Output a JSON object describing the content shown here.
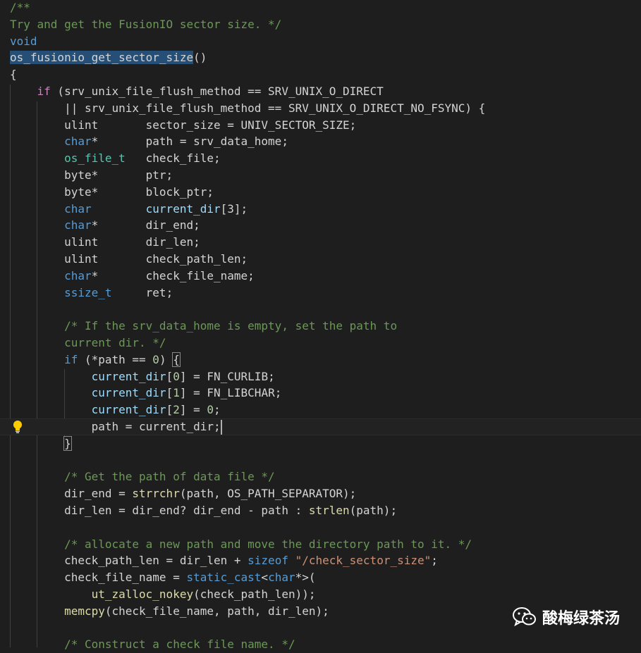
{
  "editor": {
    "lines": [
      [
        {
          "t": "/**",
          "c": "comment"
        }
      ],
      [
        {
          "t": "Try and get the FusionIO sector size. */",
          "c": "comment"
        }
      ],
      [
        {
          "t": "void",
          "c": "keyword"
        }
      ],
      [
        {
          "t": "os_fusionio_get_sector_size",
          "c": "sel"
        },
        {
          "t": "()",
          "c": "plain"
        }
      ],
      [
        {
          "t": "{",
          "c": "plain"
        }
      ],
      [
        {
          "t": "    ",
          "c": "plain"
        },
        {
          "t": "if",
          "c": "control"
        },
        {
          "t": " (srv_unix_file_flush_method == SRV_UNIX_O_DIRECT",
          "c": "plain"
        }
      ],
      [
        {
          "t": "        || srv_unix_file_flush_method == SRV_UNIX_O_DIRECT_NO_FSYNC) {",
          "c": "plain"
        }
      ],
      [
        {
          "t": "        ulint       sector_size = UNIV_SECTOR_SIZE;",
          "c": "plain"
        }
      ],
      [
        {
          "t": "        ",
          "c": "plain"
        },
        {
          "t": "char",
          "c": "keyword"
        },
        {
          "t": "*       path = srv_data_home;",
          "c": "plain"
        }
      ],
      [
        {
          "t": "        ",
          "c": "plain"
        },
        {
          "t": "os_file_t",
          "c": "type"
        },
        {
          "t": "   check_file;",
          "c": "plain"
        }
      ],
      [
        {
          "t": "        byte*       ptr;",
          "c": "plain"
        }
      ],
      [
        {
          "t": "        byte*       block_ptr;",
          "c": "plain"
        }
      ],
      [
        {
          "t": "        ",
          "c": "plain"
        },
        {
          "t": "char",
          "c": "keyword"
        },
        {
          "t": "        ",
          "c": "plain"
        },
        {
          "t": "current_dir",
          "c": "var"
        },
        {
          "t": "[3];",
          "c": "plain"
        }
      ],
      [
        {
          "t": "        ",
          "c": "plain"
        },
        {
          "t": "char",
          "c": "keyword"
        },
        {
          "t": "*       dir_end;",
          "c": "plain"
        }
      ],
      [
        {
          "t": "        ulint       dir_len;",
          "c": "plain"
        }
      ],
      [
        {
          "t": "        ulint       check_path_len;",
          "c": "plain"
        }
      ],
      [
        {
          "t": "        ",
          "c": "plain"
        },
        {
          "t": "char",
          "c": "keyword"
        },
        {
          "t": "*       check_file_name;",
          "c": "plain"
        }
      ],
      [
        {
          "t": "        ",
          "c": "plain"
        },
        {
          "t": "ssize_t",
          "c": "keyword"
        },
        {
          "t": "     ret;",
          "c": "plain"
        }
      ],
      [
        {
          "t": "",
          "c": "plain"
        }
      ],
      [
        {
          "t": "        ",
          "c": "plain"
        },
        {
          "t": "/* If the srv_data_home is empty, set the path to",
          "c": "comment"
        }
      ],
      [
        {
          "t": "        ",
          "c": "plain"
        },
        {
          "t": "current dir. */",
          "c": "comment"
        }
      ],
      [
        {
          "t": "        ",
          "c": "plain"
        },
        {
          "t": "if",
          "c": "keyword"
        },
        {
          "t": " (*path == ",
          "c": "plain"
        },
        {
          "t": "0",
          "c": "number"
        },
        {
          "t": ") ",
          "c": "plain"
        },
        {
          "t": "{",
          "c": "brace"
        }
      ],
      [
        {
          "t": "            ",
          "c": "plain"
        },
        {
          "t": "current_dir",
          "c": "var"
        },
        {
          "t": "[",
          "c": "plain"
        },
        {
          "t": "0",
          "c": "number"
        },
        {
          "t": "] = FN_CURLIB;",
          "c": "plain"
        }
      ],
      [
        {
          "t": "            ",
          "c": "plain"
        },
        {
          "t": "current_dir",
          "c": "var"
        },
        {
          "t": "[",
          "c": "plain"
        },
        {
          "t": "1",
          "c": "number"
        },
        {
          "t": "] = FN_LIBCHAR;",
          "c": "plain"
        }
      ],
      [
        {
          "t": "            ",
          "c": "plain"
        },
        {
          "t": "current_dir",
          "c": "var"
        },
        {
          "t": "[",
          "c": "plain"
        },
        {
          "t": "2",
          "c": "number"
        },
        {
          "t": "] = ",
          "c": "plain"
        },
        {
          "t": "0",
          "c": "number"
        },
        {
          "t": ";",
          "c": "plain"
        }
      ],
      [
        {
          "t": "            path = current_dir;",
          "c": "plain"
        }
      ],
      [
        {
          "t": "        ",
          "c": "plain"
        },
        {
          "t": "}",
          "c": "brace"
        }
      ],
      [
        {
          "t": "",
          "c": "plain"
        }
      ],
      [
        {
          "t": "        ",
          "c": "plain"
        },
        {
          "t": "/* Get the path of data file */",
          "c": "comment"
        }
      ],
      [
        {
          "t": "        dir_end = ",
          "c": "plain"
        },
        {
          "t": "strrchr",
          "c": "func"
        },
        {
          "t": "(path, OS_PATH_SEPARATOR);",
          "c": "plain"
        }
      ],
      [
        {
          "t": "        dir_len = dir_end? dir_end - path : ",
          "c": "plain"
        },
        {
          "t": "strlen",
          "c": "func"
        },
        {
          "t": "(path);",
          "c": "plain"
        }
      ],
      [
        {
          "t": "",
          "c": "plain"
        }
      ],
      [
        {
          "t": "        ",
          "c": "plain"
        },
        {
          "t": "/* allocate a new path and move the directory path to it. */",
          "c": "comment"
        }
      ],
      [
        {
          "t": "        check_path_len = dir_len + ",
          "c": "plain"
        },
        {
          "t": "sizeof",
          "c": "keyword"
        },
        {
          "t": " ",
          "c": "plain"
        },
        {
          "t": "\"/check_sector_size\"",
          "c": "string"
        },
        {
          "t": ";",
          "c": "plain"
        }
      ],
      [
        {
          "t": "        check_file_name = ",
          "c": "plain"
        },
        {
          "t": "static_cast",
          "c": "keyword"
        },
        {
          "t": "<",
          "c": "plain"
        },
        {
          "t": "char",
          "c": "keyword"
        },
        {
          "t": "*>(",
          "c": "plain"
        }
      ],
      [
        {
          "t": "            ",
          "c": "plain"
        },
        {
          "t": "ut_zalloc_nokey",
          "c": "func"
        },
        {
          "t": "(check_path_len));",
          "c": "plain"
        }
      ],
      [
        {
          "t": "        ",
          "c": "plain"
        },
        {
          "t": "memcpy",
          "c": "func"
        },
        {
          "t": "(check_file_name, path, dir_len);",
          "c": "plain"
        }
      ],
      [
        {
          "t": "",
          "c": "plain"
        }
      ],
      [
        {
          "t": "        ",
          "c": "plain"
        },
        {
          "t": "/* Construct a check file name. */",
          "c": "comment"
        }
      ]
    ]
  },
  "watermark": {
    "text": "酸梅绿茶汤"
  },
  "icons": {
    "lightbulb": "lightbulb-icon",
    "wechat": "wechat-icon"
  }
}
